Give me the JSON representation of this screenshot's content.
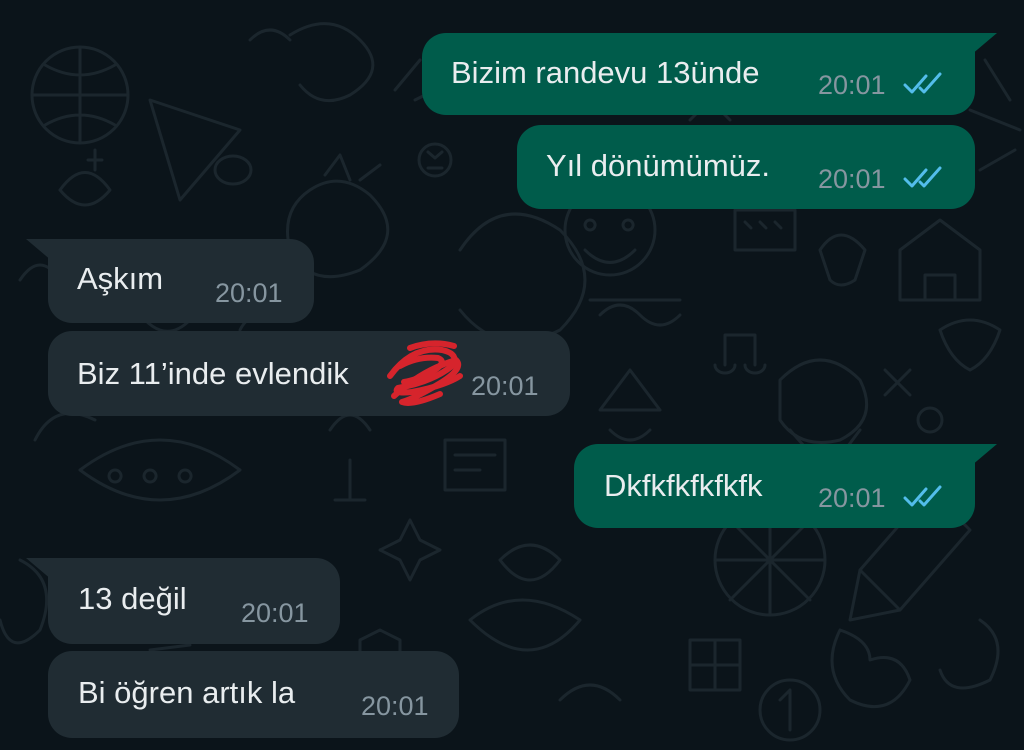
{
  "colors": {
    "chat_background": "#0b141a",
    "outgoing_bubble": "#005c4b",
    "incoming_bubble": "#202c33",
    "message_text": "#e9edef",
    "timestamp": "#8696a0",
    "read_ticks": "#53bdeb",
    "redaction_scribble": "#e0242c"
  },
  "messages": [
    {
      "direction": "outgoing",
      "text": "Bizim randevu 13ünde",
      "time": "20:01",
      "status": "read",
      "status_icon": "double-check-icon"
    },
    {
      "direction": "outgoing",
      "text": "Yıl dönümümüz.",
      "time": "20:01",
      "status": "read",
      "status_icon": "double-check-icon"
    },
    {
      "direction": "incoming",
      "text": "Aşkım",
      "time": "20:01"
    },
    {
      "direction": "incoming",
      "text": "Biz 11’inde evlendik",
      "time": "20:01",
      "redacted_icon": "red-scribble-redaction"
    },
    {
      "direction": "outgoing",
      "text": "Dkfkfkfkfkfk",
      "time": "20:01",
      "status": "read",
      "status_icon": "double-check-icon"
    },
    {
      "direction": "incoming",
      "text": "13 değil",
      "time": "20:01"
    },
    {
      "direction": "incoming",
      "text": "Bi öğren artık la",
      "time": "20:01"
    }
  ]
}
